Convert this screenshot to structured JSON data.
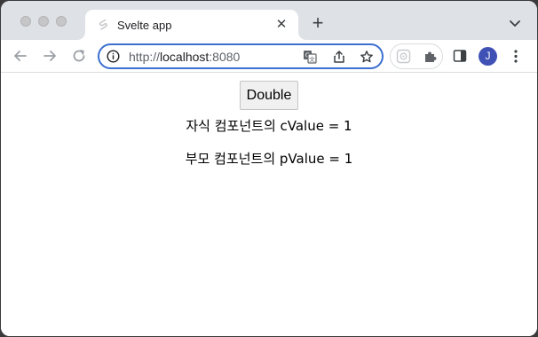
{
  "tab": {
    "title": "Svelte app",
    "close": "✕"
  },
  "new_tab": "+",
  "address_bar": {
    "scheme": "http://",
    "host": "localhost",
    "port": ":8080"
  },
  "profile": {
    "initial": "J"
  },
  "page": {
    "button_label": "Double",
    "child_text": "자식 컴포넌트의 cValue = 1",
    "parent_text": "부모 컴포넌트의 pValue = 1"
  }
}
